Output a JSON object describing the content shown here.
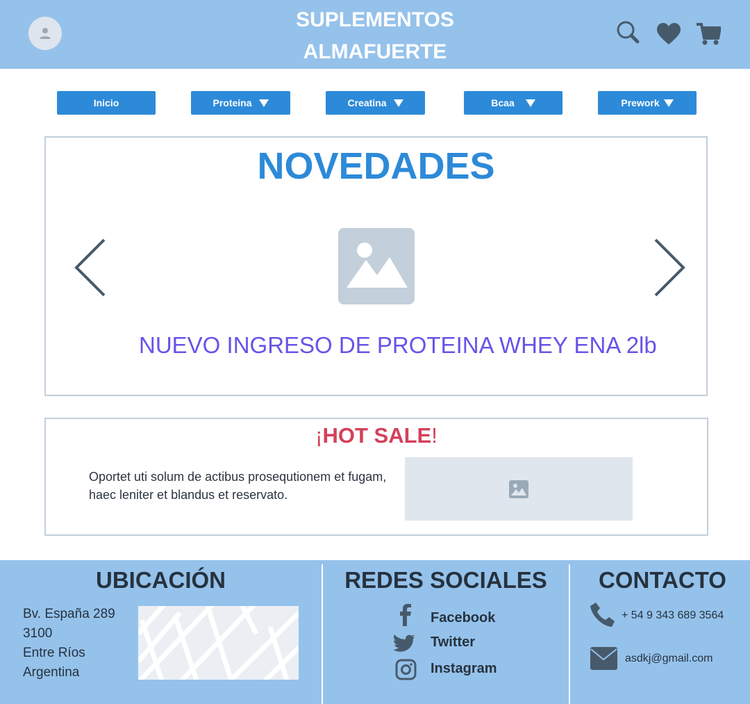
{
  "header": {
    "title_line1": "SUPLEMENTOS",
    "title_line2": "ALMAFUERTE",
    "icons": [
      "user-icon",
      "search-icon",
      "heart-icon",
      "cart-icon"
    ]
  },
  "nav": [
    {
      "label": "Inicio"
    },
    {
      "label": "Proteina"
    },
    {
      "label": "Creatina"
    },
    {
      "label": "Bcaa"
    },
    {
      "label": "Prework"
    }
  ],
  "novedades": {
    "title": "NOVEDADES",
    "caption": "NUEVO INGRESO DE PROTEINA WHEY ENA 2lb"
  },
  "hot_sale": {
    "open": "¡",
    "title": "HOT SALE",
    "close": "!",
    "text": "Oportet uti solum de actibus prosequtionem et fugam, haec leniter et blandus et reservato."
  },
  "footer": {
    "ubicacion": {
      "title": "UBICACIÓN",
      "lines": [
        "Bv. España 289",
        "3100",
        "Entre Ríos",
        "Argentina"
      ]
    },
    "redes": {
      "title": "REDES SOCIALES",
      "items": [
        {
          "label": "Facebook"
        },
        {
          "label": "Twitter"
        },
        {
          "label": "Instagram"
        }
      ]
    },
    "contacto": {
      "title": "CONTACTO",
      "phone": "+ 54 9 343 689 3564",
      "email": "asdkj@gmail.com"
    }
  },
  "colors": {
    "header": "#95c2eb",
    "accent": "#2d8ad8",
    "caption": "#6654e8",
    "hot": "#d5405a"
  }
}
